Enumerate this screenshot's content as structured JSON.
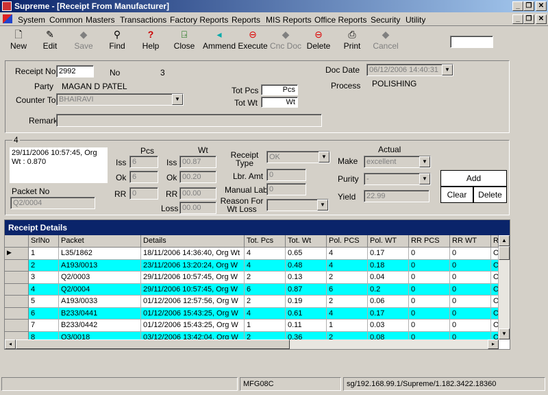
{
  "window": {
    "title": "Supreme - [Receipt From Manufacturer]",
    "minimize": "_",
    "restore": "❐",
    "close": "✕"
  },
  "menu": [
    "System",
    "Common",
    "Masters",
    "Transactions",
    "Factory Reports",
    "Reports",
    "MIS Reports",
    "Office Reports",
    "Security",
    "Utility"
  ],
  "toolbar": [
    {
      "label": "New",
      "icon": "new-document-icon",
      "glyph": "🗋",
      "enabled": true
    },
    {
      "label": "Edit",
      "icon": "edit-icon",
      "glyph": "✎",
      "enabled": true
    },
    {
      "label": "Save",
      "icon": "save-icon",
      "glyph": "◆",
      "enabled": false
    },
    {
      "label": "Find",
      "icon": "binoculars-icon",
      "glyph": "⚲",
      "enabled": true
    },
    {
      "label": "Help",
      "icon": "help-icon",
      "glyph": "?",
      "enabled": true
    },
    {
      "label": "Close",
      "icon": "close-door-icon",
      "glyph": "⍈",
      "enabled": true
    },
    {
      "label": "Ammend",
      "icon": "ammend-icon",
      "glyph": "◂",
      "enabled": true
    },
    {
      "label": "Execute",
      "icon": "execute-icon",
      "glyph": "⊖",
      "enabled": true
    },
    {
      "label": "Cnc Doc",
      "icon": "cancel-doc-icon",
      "glyph": "◆",
      "enabled": false
    },
    {
      "label": "Delete",
      "icon": "delete-icon",
      "glyph": "⊖",
      "enabled": true
    },
    {
      "label": "Print",
      "icon": "print-icon",
      "glyph": "⎙",
      "enabled": true
    },
    {
      "label": "Cancel",
      "icon": "cancel-icon",
      "glyph": "◆",
      "enabled": false
    }
  ],
  "header": {
    "receipt_no_label": "Receipt No",
    "receipt_no": "2992",
    "no_label": "No",
    "no_value": "3",
    "doc_date_label": "Doc Date",
    "doc_date": "06/12/2006 14:40:31",
    "party_label": "Party",
    "party": "MAGAN D PATEL",
    "process_label": "Process",
    "process": "POLISHING",
    "counter_label": "Counter To",
    "counter": "BHAIRAVI",
    "tot_pcs_label": "Tot Pcs",
    "tot_pcs_unit": "Pcs",
    "tot_wt_label": "Tot Wt",
    "tot_wt_unit": "Wt",
    "remark_label": "Remark",
    "remark": ""
  },
  "detail": {
    "group_number": "4",
    "info_line1": "29/11/2006 10:57:45, Org",
    "info_line2": "Wt : 0.870",
    "packet_no_label": "Packet No",
    "packet_no": "Q2/0004",
    "pcs_label": "Pcs",
    "wt_label": "Wt",
    "iss_label": "Iss",
    "ok_label": "Ok",
    "rr_label": "RR",
    "loss_label": "Loss",
    "iss_pcs": "6",
    "ok_pcs": "6",
    "rr_pcs": "0",
    "iss_wt": "00.87",
    "ok_wt": "00.20",
    "rr_wt": "00.00",
    "loss_wt": "00.00",
    "receipt_type_label": "Receipt Type",
    "receipt_type": "OK",
    "lbr_amt_label": "Lbr. Amt",
    "lbr_amt": "0",
    "manual_lab_label": "Manual Lab",
    "manual_lab": "0",
    "reason_label": "Reason For Wt Loss",
    "reason": "",
    "actual_label": "Actual",
    "make_label": "Make",
    "make": "excellent",
    "purity_label": "Purity",
    "purity": "-",
    "yield_label": "Yield",
    "yield": "22.99",
    "add_button": "Add",
    "clear_button": "Clear",
    "delete_button": "Delete"
  },
  "grid": {
    "title": "Receipt Details",
    "columns": [
      "SrlNo",
      "Packet",
      "Details",
      "Tot. Pcs",
      "Tot. Wt",
      "Pol. PCS",
      "Pol. WT",
      "RR PCS",
      "RR WT",
      "Re"
    ],
    "rows": [
      [
        "1",
        "L35/1862",
        "18/11/2006 14:36:40, Org Wt",
        "4",
        "0.65",
        "4",
        "0.17",
        "0",
        "0",
        "OK"
      ],
      [
        "2",
        "A193/0013",
        "23/11/2006 13:20:24, Org W",
        "4",
        "0.48",
        "4",
        "0.18",
        "0",
        "0",
        "OK"
      ],
      [
        "3",
        "Q2/0003",
        "29/11/2006 10:57:45, Org W",
        "2",
        "0.13",
        "2",
        "0.04",
        "0",
        "0",
        "OK"
      ],
      [
        "4",
        "Q2/0004",
        "29/11/2006 10:57:45, Org W",
        "6",
        "0.87",
        "6",
        "0.2",
        "0",
        "0",
        "OK"
      ],
      [
        "5",
        "A193/0033",
        "01/12/2006 12:57:56, Org W",
        "2",
        "0.19",
        "2",
        "0.06",
        "0",
        "0",
        "OK"
      ],
      [
        "6",
        "B233/0441",
        "01/12/2006 15:43:25, Org W",
        "4",
        "0.61",
        "4",
        "0.17",
        "0",
        "0",
        "OK"
      ],
      [
        "7",
        "B233/0442",
        "01/12/2006 15:43:25, Org W",
        "1",
        "0.11",
        "1",
        "0.03",
        "0",
        "0",
        "OK"
      ],
      [
        "8",
        "Q3/0018",
        "03/12/2006 13:42:04, Org W",
        "2",
        "0.36",
        "2",
        "0.08",
        "0",
        "0",
        "OK"
      ]
    ],
    "highlight_color": "#00ffff"
  },
  "status": {
    "left": "",
    "middle": "MFG08C",
    "right": "sg/192.168.99.1/Supreme/1.182.3422.18360"
  }
}
